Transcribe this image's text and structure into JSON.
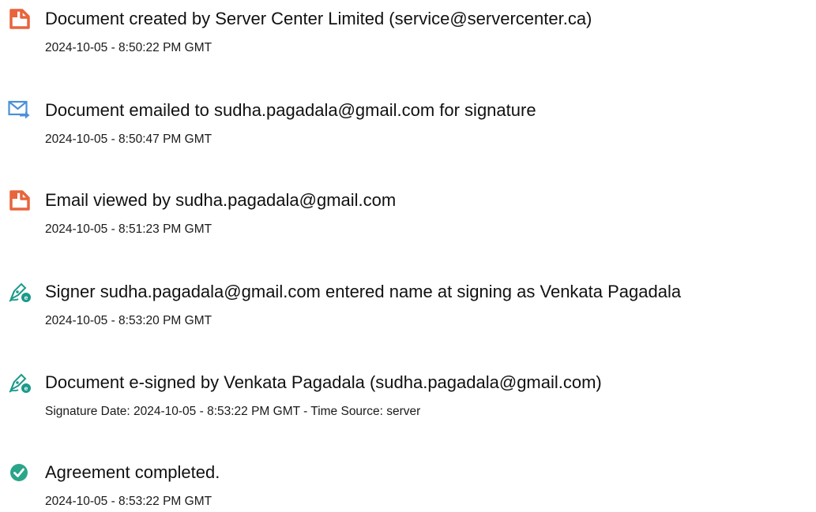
{
  "events": [
    {
      "icon": "document-created-icon",
      "title": "Document created by Server Center Limited (service@servercenter.ca)",
      "meta": "2024-10-05 - 8:50:22 PM GMT"
    },
    {
      "icon": "email-sent-icon",
      "title": "Document emailed to sudha.pagadala@gmail.com for signature",
      "meta": "2024-10-05 - 8:50:47 PM GMT"
    },
    {
      "icon": "document-viewed-icon",
      "title": "Email viewed by sudha.pagadala@gmail.com",
      "meta": "2024-10-05 - 8:51:23 PM GMT"
    },
    {
      "icon": "e-sign-pen-icon",
      "title": "Signer sudha.pagadala@gmail.com entered name at signing as Venkata Pagadala",
      "meta": "2024-10-05 - 8:53:20 PM GMT"
    },
    {
      "icon": "e-sign-pen-icon",
      "title": "Document e-signed by Venkata Pagadala (sudha.pagadala@gmail.com)",
      "meta": "Signature Date: 2024-10-05 - 8:53:22 PM GMT - Time Source: server"
    },
    {
      "icon": "check-circle-icon",
      "title": "Agreement completed.",
      "meta": "2024-10-05 - 8:53:22 PM GMT"
    }
  ],
  "colors": {
    "document_icon": "#e8643c",
    "email_icon": "#4a90d9",
    "sign_icon": "#1a9a8a",
    "check_icon": "#2aa58a"
  }
}
